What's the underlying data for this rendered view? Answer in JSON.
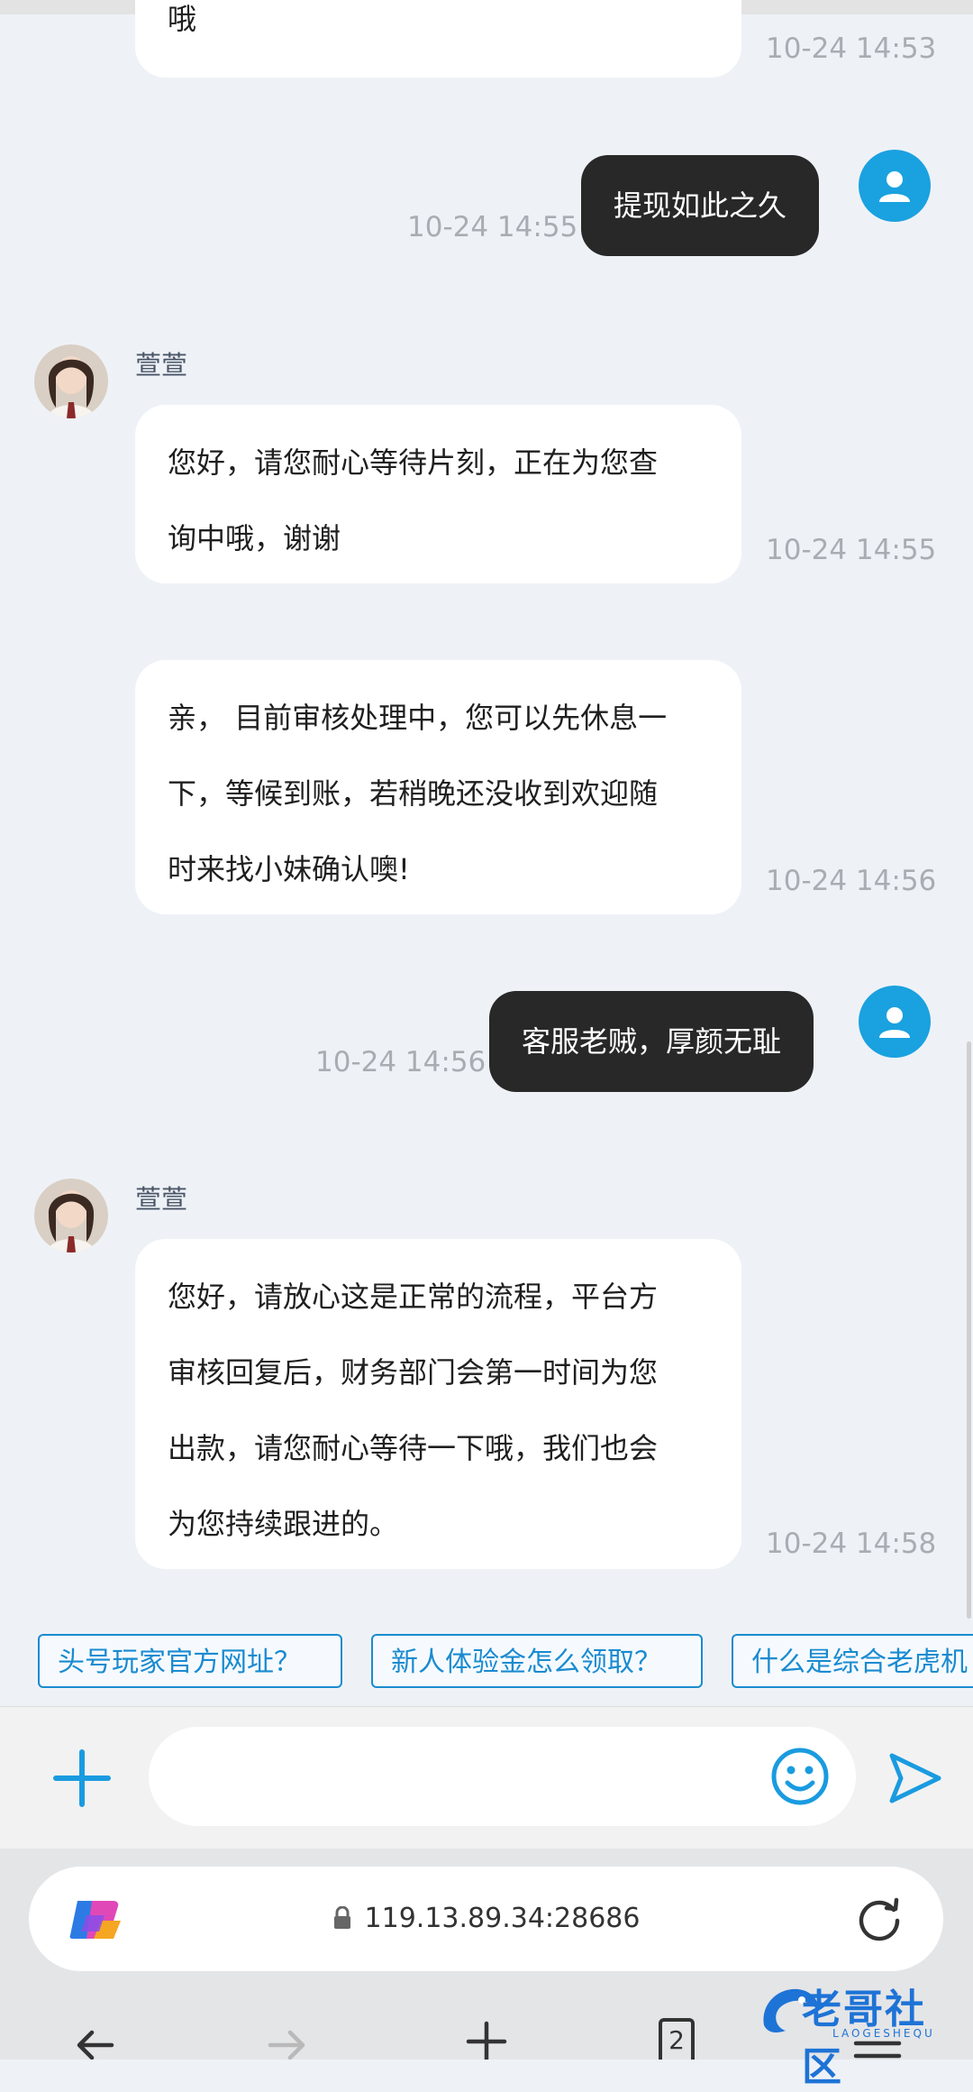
{
  "messages": {
    "m0": {
      "text": "哦",
      "time": "10-24 14:53"
    },
    "m1": {
      "text": "提现如此之久",
      "time": "10-24 14:55"
    },
    "m2": {
      "sender": "萱萱",
      "line1": "您好，请您耐心等待片刻，正在为您查",
      "line2": "询中哦，谢谢",
      "time": "10-24 14:55"
    },
    "m3": {
      "line1": "亲， 目前审核处理中，您可以先休息一",
      "line2": "下，等候到账，若稍晚还没收到欢迎随",
      "line3": "时来找小妹确认噢!",
      "time": "10-24 14:56"
    },
    "m4": {
      "text": "客服老贼，厚颜无耻",
      "time": "10-24 14:56"
    },
    "m5": {
      "sender": "萱萱",
      "line1": "您好，请放心这是正常的流程，平台方",
      "line2": "审核回复后，财务部门会第一时间为您",
      "line3": "出款，请您耐心等待一下哦，我们也会",
      "line4": "为您持续跟进的。",
      "time": "10-24 14:58"
    }
  },
  "quick_questions": [
    "头号玩家官方网址？",
    "新人体验金怎么领取？",
    "什么是综合老虎机"
  ],
  "input": {
    "placeholder": ""
  },
  "browser": {
    "url": "119.13.89.34:28686",
    "tab_count": "2"
  },
  "watermark": {
    "text": "老哥社区",
    "sub": "LAOGESHEQU"
  },
  "colors": {
    "accent": "#1aa1e0",
    "outgoing_bubble": "#282828",
    "chip_border": "#1a8bd0"
  }
}
